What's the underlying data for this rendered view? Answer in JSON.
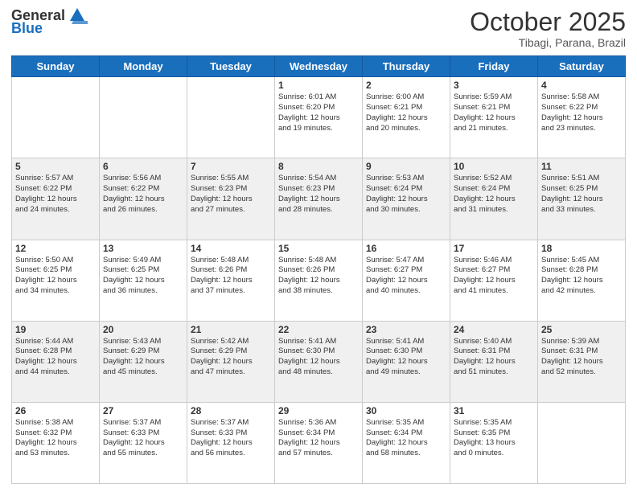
{
  "logo": {
    "line1": "General",
    "line2": "Blue"
  },
  "title": "October 2025",
  "subtitle": "Tibagi, Parana, Brazil",
  "weekdays": [
    "Sunday",
    "Monday",
    "Tuesday",
    "Wednesday",
    "Thursday",
    "Friday",
    "Saturday"
  ],
  "weeks": [
    [
      {
        "day": "",
        "info": ""
      },
      {
        "day": "",
        "info": ""
      },
      {
        "day": "",
        "info": ""
      },
      {
        "day": "1",
        "info": "Sunrise: 6:01 AM\nSunset: 6:20 PM\nDaylight: 12 hours\nand 19 minutes."
      },
      {
        "day": "2",
        "info": "Sunrise: 6:00 AM\nSunset: 6:21 PM\nDaylight: 12 hours\nand 20 minutes."
      },
      {
        "day": "3",
        "info": "Sunrise: 5:59 AM\nSunset: 6:21 PM\nDaylight: 12 hours\nand 21 minutes."
      },
      {
        "day": "4",
        "info": "Sunrise: 5:58 AM\nSunset: 6:22 PM\nDaylight: 12 hours\nand 23 minutes."
      }
    ],
    [
      {
        "day": "5",
        "info": "Sunrise: 5:57 AM\nSunset: 6:22 PM\nDaylight: 12 hours\nand 24 minutes."
      },
      {
        "day": "6",
        "info": "Sunrise: 5:56 AM\nSunset: 6:22 PM\nDaylight: 12 hours\nand 26 minutes."
      },
      {
        "day": "7",
        "info": "Sunrise: 5:55 AM\nSunset: 6:23 PM\nDaylight: 12 hours\nand 27 minutes."
      },
      {
        "day": "8",
        "info": "Sunrise: 5:54 AM\nSunset: 6:23 PM\nDaylight: 12 hours\nand 28 minutes."
      },
      {
        "day": "9",
        "info": "Sunrise: 5:53 AM\nSunset: 6:24 PM\nDaylight: 12 hours\nand 30 minutes."
      },
      {
        "day": "10",
        "info": "Sunrise: 5:52 AM\nSunset: 6:24 PM\nDaylight: 12 hours\nand 31 minutes."
      },
      {
        "day": "11",
        "info": "Sunrise: 5:51 AM\nSunset: 6:25 PM\nDaylight: 12 hours\nand 33 minutes."
      }
    ],
    [
      {
        "day": "12",
        "info": "Sunrise: 5:50 AM\nSunset: 6:25 PM\nDaylight: 12 hours\nand 34 minutes."
      },
      {
        "day": "13",
        "info": "Sunrise: 5:49 AM\nSunset: 6:25 PM\nDaylight: 12 hours\nand 36 minutes."
      },
      {
        "day": "14",
        "info": "Sunrise: 5:48 AM\nSunset: 6:26 PM\nDaylight: 12 hours\nand 37 minutes."
      },
      {
        "day": "15",
        "info": "Sunrise: 5:48 AM\nSunset: 6:26 PM\nDaylight: 12 hours\nand 38 minutes."
      },
      {
        "day": "16",
        "info": "Sunrise: 5:47 AM\nSunset: 6:27 PM\nDaylight: 12 hours\nand 40 minutes."
      },
      {
        "day": "17",
        "info": "Sunrise: 5:46 AM\nSunset: 6:27 PM\nDaylight: 12 hours\nand 41 minutes."
      },
      {
        "day": "18",
        "info": "Sunrise: 5:45 AM\nSunset: 6:28 PM\nDaylight: 12 hours\nand 42 minutes."
      }
    ],
    [
      {
        "day": "19",
        "info": "Sunrise: 5:44 AM\nSunset: 6:28 PM\nDaylight: 12 hours\nand 44 minutes."
      },
      {
        "day": "20",
        "info": "Sunrise: 5:43 AM\nSunset: 6:29 PM\nDaylight: 12 hours\nand 45 minutes."
      },
      {
        "day": "21",
        "info": "Sunrise: 5:42 AM\nSunset: 6:29 PM\nDaylight: 12 hours\nand 47 minutes."
      },
      {
        "day": "22",
        "info": "Sunrise: 5:41 AM\nSunset: 6:30 PM\nDaylight: 12 hours\nand 48 minutes."
      },
      {
        "day": "23",
        "info": "Sunrise: 5:41 AM\nSunset: 6:30 PM\nDaylight: 12 hours\nand 49 minutes."
      },
      {
        "day": "24",
        "info": "Sunrise: 5:40 AM\nSunset: 6:31 PM\nDaylight: 12 hours\nand 51 minutes."
      },
      {
        "day": "25",
        "info": "Sunrise: 5:39 AM\nSunset: 6:31 PM\nDaylight: 12 hours\nand 52 minutes."
      }
    ],
    [
      {
        "day": "26",
        "info": "Sunrise: 5:38 AM\nSunset: 6:32 PM\nDaylight: 12 hours\nand 53 minutes."
      },
      {
        "day": "27",
        "info": "Sunrise: 5:37 AM\nSunset: 6:33 PM\nDaylight: 12 hours\nand 55 minutes."
      },
      {
        "day": "28",
        "info": "Sunrise: 5:37 AM\nSunset: 6:33 PM\nDaylight: 12 hours\nand 56 minutes."
      },
      {
        "day": "29",
        "info": "Sunrise: 5:36 AM\nSunset: 6:34 PM\nDaylight: 12 hours\nand 57 minutes."
      },
      {
        "day": "30",
        "info": "Sunrise: 5:35 AM\nSunset: 6:34 PM\nDaylight: 12 hours\nand 58 minutes."
      },
      {
        "day": "31",
        "info": "Sunrise: 5:35 AM\nSunset: 6:35 PM\nDaylight: 13 hours\nand 0 minutes."
      },
      {
        "day": "",
        "info": ""
      }
    ]
  ]
}
